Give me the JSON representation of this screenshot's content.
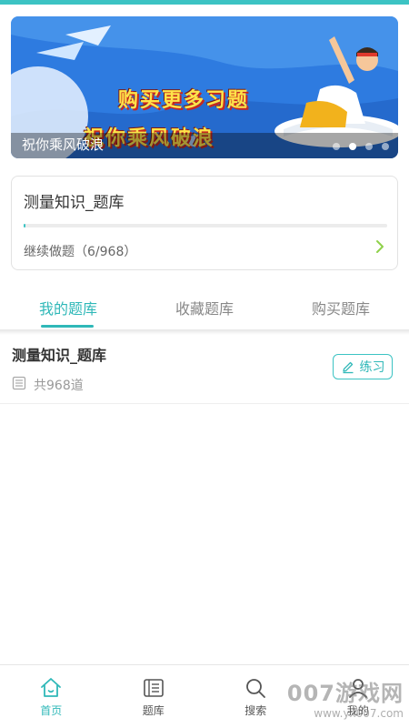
{
  "colors": {
    "accent": "#2fb8b8",
    "top_bar": "#3cc3c3",
    "banner_blue": "#2e7be0"
  },
  "banner": {
    "headline_line1": "购买更多习题",
    "headline_line2": "祝你乘风破浪",
    "caption": "祝你乘风破浪",
    "slide_count": 4,
    "active_slide": 2
  },
  "progress_card": {
    "title": "测量知识_题库",
    "continue_text": "继续做题（6/968）",
    "done": 6,
    "total": 968
  },
  "tabs": [
    {
      "label": "我的题库",
      "active": true
    },
    {
      "label": "收藏题库",
      "active": false
    },
    {
      "label": "购买题库",
      "active": false
    }
  ],
  "bank_list": [
    {
      "title": "测量知识_题库",
      "count_text": "共968道",
      "action_label": "练习"
    }
  ],
  "bottom_nav": [
    {
      "label": "首页",
      "icon": "home-icon",
      "active": true
    },
    {
      "label": "题库",
      "icon": "question-bank-icon",
      "active": false
    },
    {
      "label": "搜索",
      "icon": "search-icon",
      "active": false
    },
    {
      "label": "我的",
      "icon": "profile-icon",
      "active": false
    }
  ],
  "watermark": {
    "line1": "007游戏网",
    "line2": "www.yx007.com"
  }
}
